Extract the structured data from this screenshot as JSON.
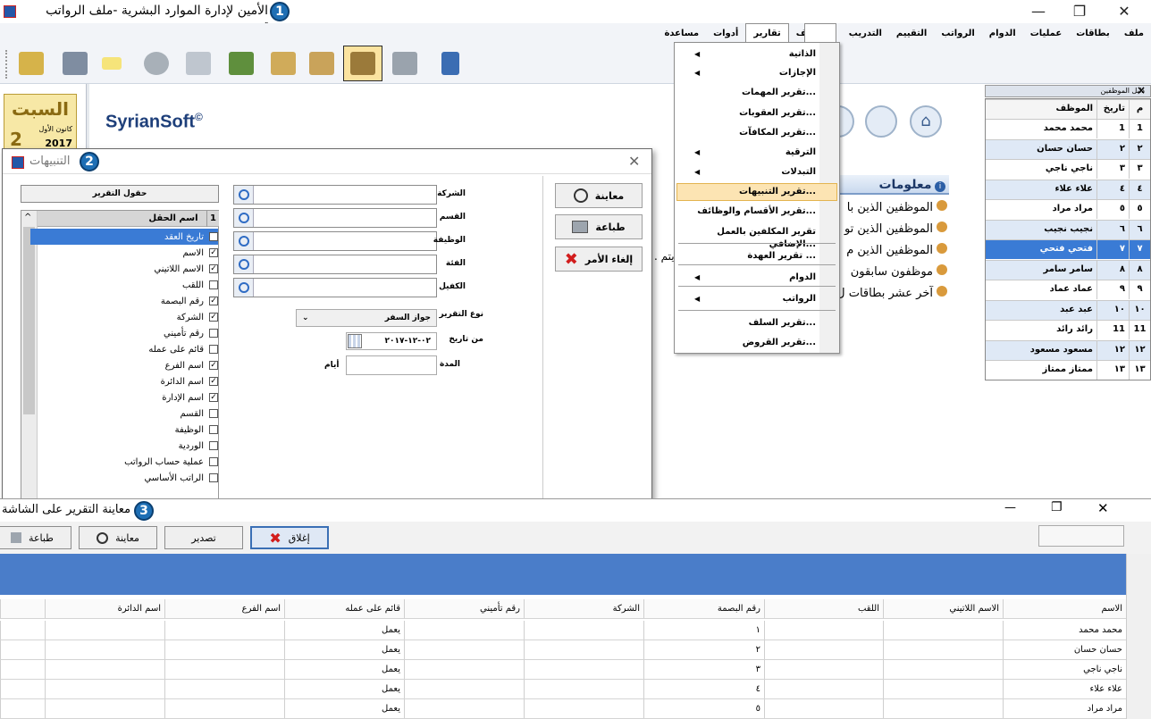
{
  "app": {
    "title": "الأمين لإدارة الموارد البشرية -ملف الرواتب تجريبي",
    "badge1": "1",
    "menu": [
      "ملف",
      "بطاقات",
      "عمليات",
      "الدوام",
      "الرواتب",
      "التقييم",
      "التدريب",
      "التوظيف",
      "تقارير",
      "أدوات",
      "مساعدة"
    ],
    "controls": {
      "minimize": "—",
      "maximize": "❐",
      "close": "✕"
    }
  },
  "calendar": {
    "day": "السبت",
    "month": "كانون الأول",
    "year": "2017",
    "date": "2"
  },
  "brand": {
    "name": "SyrianSoft",
    "reg": "©"
  },
  "info": {
    "title": "معلومات",
    "items": [
      "الموظفين الذين با",
      "الموظفين الذين تو",
      "الموظفين الذين م",
      "موظفون سابقون",
      "آخر عشر بطاقات ل"
    ],
    "partial": "يتم ."
  },
  "reports_menu": {
    "items": [
      {
        "label": "الذاتية",
        "sub": true
      },
      {
        "label": "الإجازات",
        "sub": true
      },
      {
        "label": "تقرير المهمات...",
        "sub": false
      },
      {
        "label": "تقرير العقوبات...",
        "sub": false
      },
      {
        "label": "تقرير المكافآت...",
        "sub": false
      },
      {
        "label": "الترقية",
        "sub": true
      },
      {
        "label": "التبدلات",
        "sub": true
      },
      {
        "label": "تقرير التنبيهات...",
        "sub": false,
        "highlight": true
      },
      {
        "label": "تقرير الأقسام والوظائف...",
        "sub": false
      },
      {
        "label": "تقرير المكلفين بالعمل الإضافي...",
        "sub": false
      },
      {
        "label": "تقرير العهدة ...",
        "sub": false
      },
      {
        "label": "الدوام",
        "sub": true
      },
      {
        "label": "الرواتب",
        "sub": true
      },
      {
        "label": "تقرير السلف...",
        "sub": false
      },
      {
        "label": "تقرير القروض...",
        "sub": false
      }
    ]
  },
  "employee_guide": {
    "title": "دليل الموظفين",
    "close": "×",
    "headers": [
      "م",
      "تاريخ العقد",
      "الموظف"
    ],
    "rows": [
      [
        "1",
        "1",
        "محمد محمد"
      ],
      [
        "٢",
        "٢",
        "حسان حسان"
      ],
      [
        "٣",
        "٣",
        "ناجي ناجي"
      ],
      [
        "٤",
        "٤",
        "علاء علاء"
      ],
      [
        "٥",
        "٥",
        "مراد مراد"
      ],
      [
        "٦",
        "٦",
        "نجيب نجيب"
      ],
      [
        "٧",
        "٧",
        "فتحي فتحي"
      ],
      [
        "٨",
        "٨",
        "سامر سامر"
      ],
      [
        "٩",
        "٩",
        "عماد عماد"
      ],
      [
        "١٠",
        "١٠",
        "عبد عبد"
      ],
      [
        "11",
        "11",
        "رائد رائد"
      ],
      [
        "١٢",
        "١٢",
        "مسعود مسعود"
      ],
      [
        "١٣",
        "١٣",
        "ممتاز ممتاز"
      ]
    ],
    "selected_index": 6
  },
  "alerts_dialog": {
    "title": "التنبيهات",
    "badge": "2",
    "close": "✕",
    "fields_header": "حقول التقرير",
    "list_header": {
      "num": "1",
      "name": "اسم الحقل"
    },
    "fields": [
      {
        "label": "تاريخ العقد",
        "checked": true,
        "selected": true
      },
      {
        "label": "الاسم",
        "checked": true
      },
      {
        "label": "الاسم اللاتيني",
        "checked": true
      },
      {
        "label": "اللقب",
        "checked": false
      },
      {
        "label": "رقم البصمة",
        "checked": true
      },
      {
        "label": "الشركة",
        "checked": true
      },
      {
        "label": "رقم تأميني",
        "checked": false
      },
      {
        "label": "قائم على عمله",
        "checked": false
      },
      {
        "label": "اسم الفرع",
        "checked": true
      },
      {
        "label": "اسم الدائرة",
        "checked": true
      },
      {
        "label": "اسم الإدارة",
        "checked": true
      },
      {
        "label": "القسم",
        "checked": false
      },
      {
        "label": "الوظيفة",
        "checked": false
      },
      {
        "label": "الوردية",
        "checked": false
      },
      {
        "label": "عملية حساب الرواتب",
        "checked": false
      },
      {
        "label": "الراتب الأساسي",
        "checked": false
      }
    ],
    "filters": [
      "الشركة",
      "القسم",
      "الوظيفة",
      "الفئة",
      "الكفيل"
    ],
    "report_type_label": "نوع التقرير",
    "report_type_value": "جواز السفر",
    "from_date_label": "من تاريخ",
    "from_date_value": "٠٢-١٢-٢٠١٧",
    "period_label": "المدة",
    "period_unit": "أيام",
    "buttons": {
      "preview": "معاينة",
      "print": "طباعة",
      "cancel": "إلغاء الأمر"
    }
  },
  "preview_window": {
    "title": "معاينة التقرير على الشاشة",
    "badge": "3",
    "buttons": {
      "close": "إغلاق",
      "export": "تصدير",
      "preview": "معاينة",
      "print": "طباعة"
    },
    "columns": [
      "الاسم",
      "الاسم اللاتيني",
      "اللقب",
      "رقم البصمة",
      "الشركة",
      "رقم تأميني",
      "قائم على عمله",
      "اسم الفرع",
      "اسم الدائرة"
    ],
    "rows": [
      {
        "name": "محمد محمد",
        "finger": "١",
        "working": "يعمل"
      },
      {
        "name": "حسان حسان",
        "finger": "٢",
        "working": "يعمل"
      },
      {
        "name": "ناجي ناجي",
        "finger": "٣",
        "working": "يعمل"
      },
      {
        "name": "علاء علاء",
        "finger": "٤",
        "working": "يعمل"
      },
      {
        "name": "مراد مراد",
        "finger": "٥",
        "working": "يعمل"
      }
    ]
  }
}
